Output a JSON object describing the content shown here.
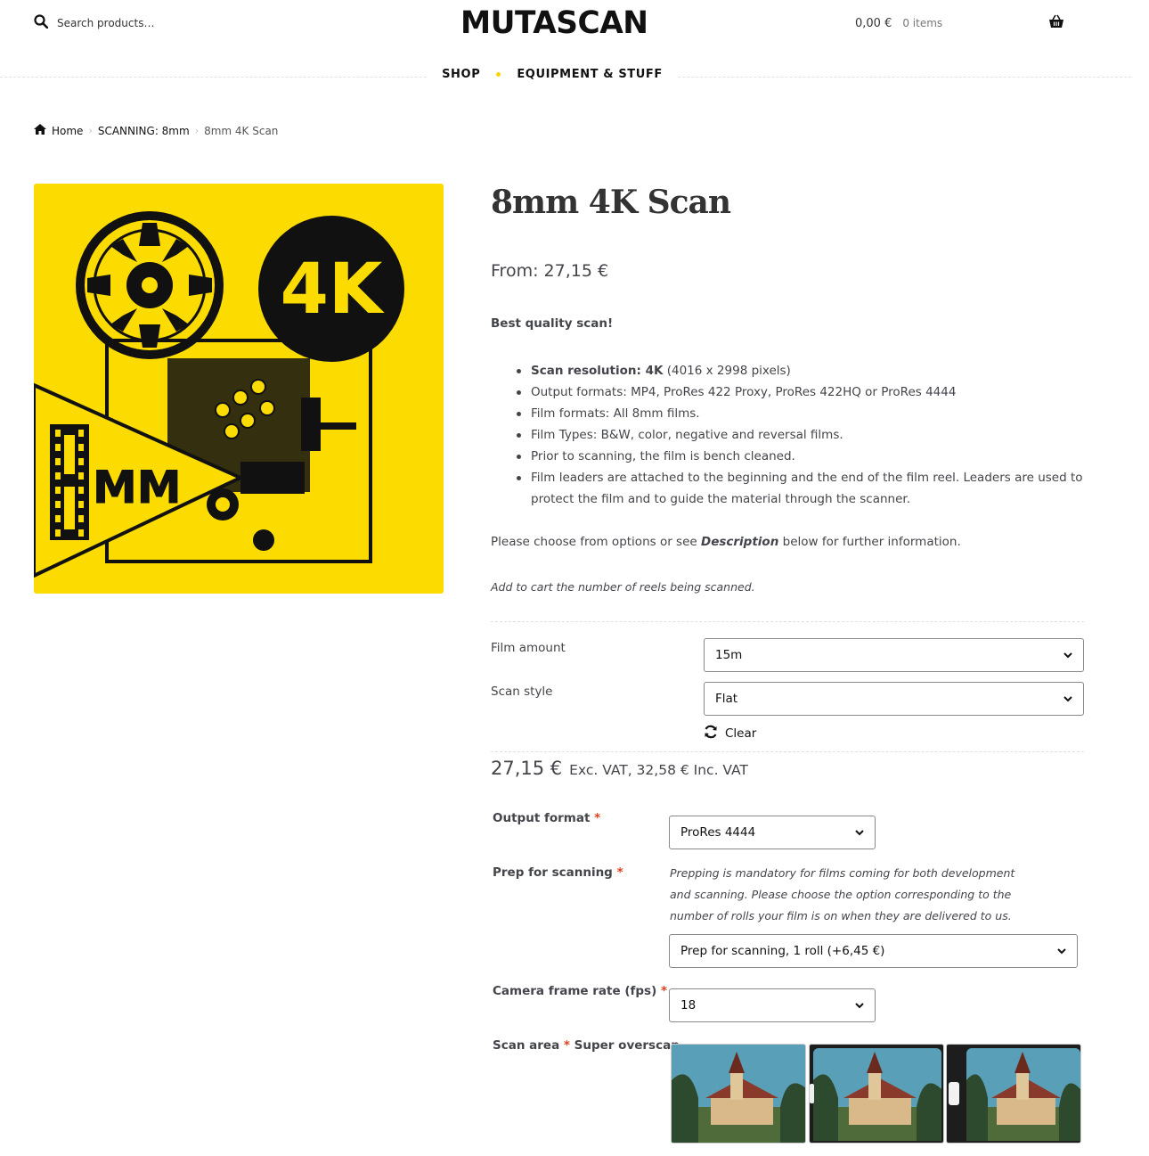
{
  "header": {
    "search_placeholder": "Search products…",
    "logo": "MUTASCAN",
    "cart_total": "0,00 €",
    "cart_count": "0 items"
  },
  "nav": {
    "items": [
      "SHOP",
      "EQUIPMENT & STUFF"
    ]
  },
  "breadcrumb": {
    "home": "Home",
    "category": "SCANNING: 8mm",
    "current": "8mm 4K Scan"
  },
  "product": {
    "image_text": {
      "big": "4K",
      "small": "MM"
    },
    "title": "8mm 4K Scan",
    "price_from": "From: 27,15 €",
    "lead": "Best quality scan!",
    "features": {
      "f1_bold": "Scan resolution: 4K",
      "f1_rest": " (4016 x 2998 pixels)",
      "f2": "Output formats: MP4, ProRes 422 Proxy, ProRes 422HQ or ProRes 4444",
      "f3": "Film formats: All 8mm films.",
      "f4": "Film Types: B&W, color, negative and reversal films.",
      "f5": "Prior to scanning, the film is bench cleaned.",
      "f6": "Film leaders are attached to the beginning and the end of the film reel. Leaders are used to protect the film and to guide the material through the scanner."
    },
    "choose_pre": "Please choose from options or see ",
    "choose_em": "Description",
    "choose_post": " below for further information.",
    "note": "Add to cart the number of reels being scanned."
  },
  "variations": {
    "film_amount_label": "Film amount",
    "film_amount_value": "15m",
    "scan_style_label": "Scan style",
    "scan_style_value": "Flat",
    "clear": "Clear",
    "price": "27,15 €",
    "vat_text": "Exc. VAT, 32,58 € Inc. VAT"
  },
  "options": {
    "output_format_label": "Output format",
    "output_format_value": "ProRes 4444",
    "prep_label": "Prep for scanning",
    "prep_desc": "Prepping is mandatory for films coming for both development and scanning. Please choose the option corresponding to the number of rolls your film is on when they are delivered to us.",
    "prep_value": "Prep for scanning, 1 roll (+6,45 €)",
    "fps_label": "Camera frame rate (fps)",
    "fps_value": "18",
    "scan_area_label": "Scan area",
    "scan_area_value": "Super overscan",
    "required_mark": "*"
  },
  "colors": {
    "brand_yellow": "#fcdb00",
    "required": "#e2401c",
    "text": "#43454b"
  }
}
